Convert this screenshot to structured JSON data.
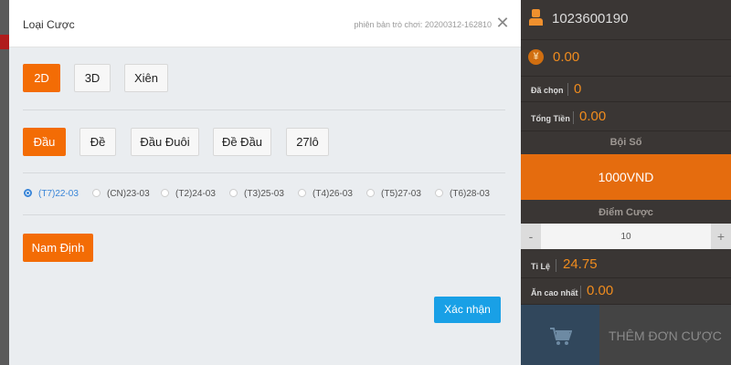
{
  "modal": {
    "title": "Loại Cược",
    "version": "phiên bản trò chơi: 20200312-162810",
    "close_glyph": "✕",
    "game_tabs": [
      "2D",
      "3D",
      "Xiên"
    ],
    "bet_types": [
      "Đầu",
      "Đề",
      "Đầu Đuôi",
      "Đề Đầu",
      "27lô"
    ],
    "dates": [
      "(T7)22-03",
      "(CN)23-03",
      "(T2)24-03",
      "(T3)25-03",
      "(T4)26-03",
      "(T5)27-03",
      "(T6)28-03"
    ],
    "selected_date": "(T7)22-03",
    "region": "Nam Định",
    "confirm_label": "Xác nhận",
    "accent_color": "#f36c05",
    "confirm_color": "#19a0e6"
  },
  "panel": {
    "user_icon": "user-icon",
    "username": "1023600190",
    "balance_icon": "yen-icon",
    "balance_glyph": "¥",
    "balance": "0.00",
    "selected_label": "Đã chọn",
    "selected_value": "0",
    "total_label": "Tổng Tiền",
    "total_value": "0.00",
    "multiplier_title": "Bội Số",
    "multiplier_value": "1000VND",
    "points_title": "Điểm Cược",
    "points_value": "10",
    "minus_glyph": "-",
    "plus_glyph": "+",
    "rate_label": "Tỉ Lệ",
    "rate_value": "24.75",
    "max_win_label": "Ăn cao nhất",
    "max_win_value": "0.00",
    "cart_icon": "cart-icon",
    "add_label": "THÊM ĐƠN CƯỢC"
  }
}
